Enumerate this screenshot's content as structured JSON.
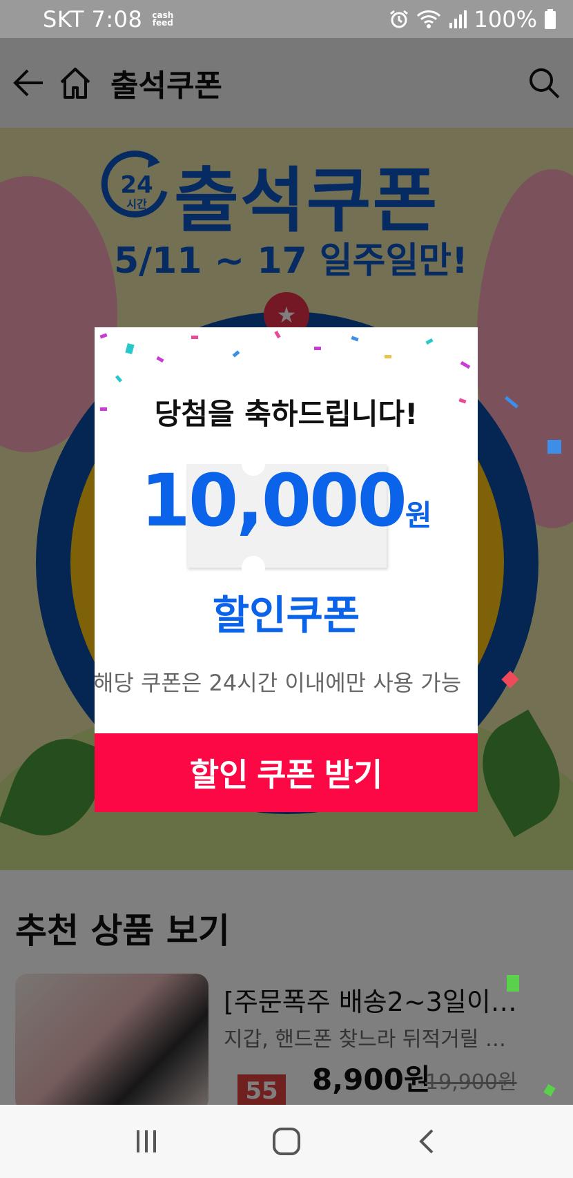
{
  "status_bar": {
    "carrier_time": "SKT 7:08",
    "cashfeed_top": "cash",
    "cashfeed_bottom": "feed",
    "battery": "100%"
  },
  "app_bar": {
    "title": "출석쿠폰"
  },
  "banner": {
    "logo_number": "24",
    "logo_unit": "시간",
    "title": "출석쿠폰",
    "date": "5/11 ~ 17 일주일만!"
  },
  "modal": {
    "heading": "당첨을 축하드립니다!",
    "amount": "10,000",
    "amount_unit": "원",
    "coupon_label": "할인쿠폰",
    "notice": "해당 쿠폰은 24시간 이내에만 사용 가능",
    "cta": "할인 쿠폰 받기"
  },
  "recommended": {
    "title": "추천 상품 보기",
    "products": [
      {
        "title": "[주문폭주 배송2~3일이…",
        "desc": "지갑, 핸드폰 찾느라 뒤적거릴 …",
        "discount_badge": "55",
        "price": "8,900원",
        "original_price": "19,900원"
      }
    ]
  },
  "colors": {
    "accent_blue": "#0a63e8",
    "cta_red": "#fb0845",
    "banner_blue": "#0d56c7"
  }
}
